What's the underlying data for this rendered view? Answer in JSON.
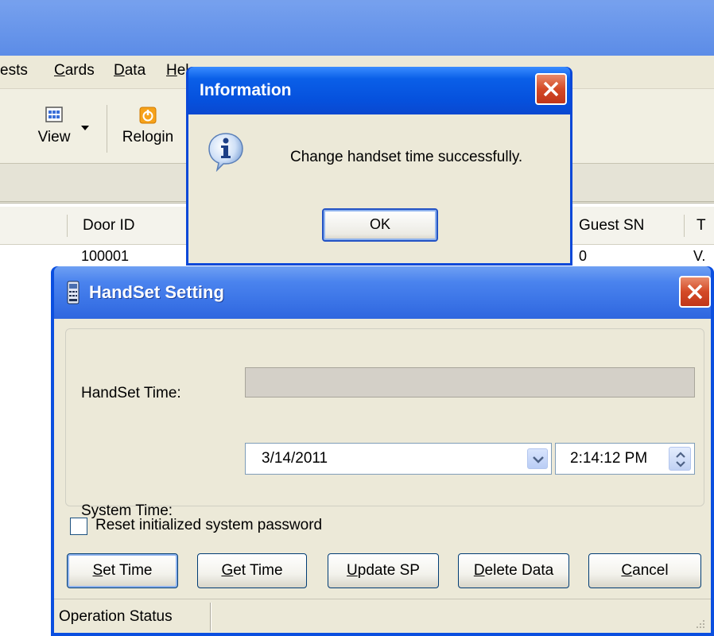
{
  "menubar": {
    "items": [
      {
        "label": "ests",
        "mnemonic": ""
      },
      {
        "label": "Cards",
        "mnemonic": "C"
      },
      {
        "label": "Data",
        "mnemonic": "D"
      },
      {
        "label": "Hel",
        "mnemonic": "H"
      }
    ]
  },
  "toolbar": {
    "view_label": "View",
    "relogin_label": "Relogin"
  },
  "grid": {
    "columns": [
      "Door ID",
      "Guest SN",
      "T"
    ],
    "row": {
      "door_id": "100001",
      "guest_sn": "0",
      "t": "V."
    }
  },
  "info_dialog": {
    "title": "Information",
    "message": "Change handset time successfully.",
    "ok_label": "OK",
    "icon": "info-icon"
  },
  "handset_dialog": {
    "title": "HandSet Setting",
    "handset_time_label": "HandSet Time:",
    "handset_time_value": "",
    "system_time_label": "System Time:",
    "system_date": "3/14/2011",
    "system_time": "2:14:12 PM",
    "reset_checkbox_label": "Reset initialized system password",
    "reset_checked": false,
    "buttons": {
      "set_time": "Set Time",
      "get_time": "Get Time",
      "update_sp": "Update SP",
      "delete_data": "Delete Data",
      "cancel": "Cancel"
    },
    "status_text": "Operation Status"
  },
  "colors": {
    "titlebar_blue": "#0a4fe0",
    "dialog_face": "#ece9d8",
    "close_red": "#d44a26"
  }
}
